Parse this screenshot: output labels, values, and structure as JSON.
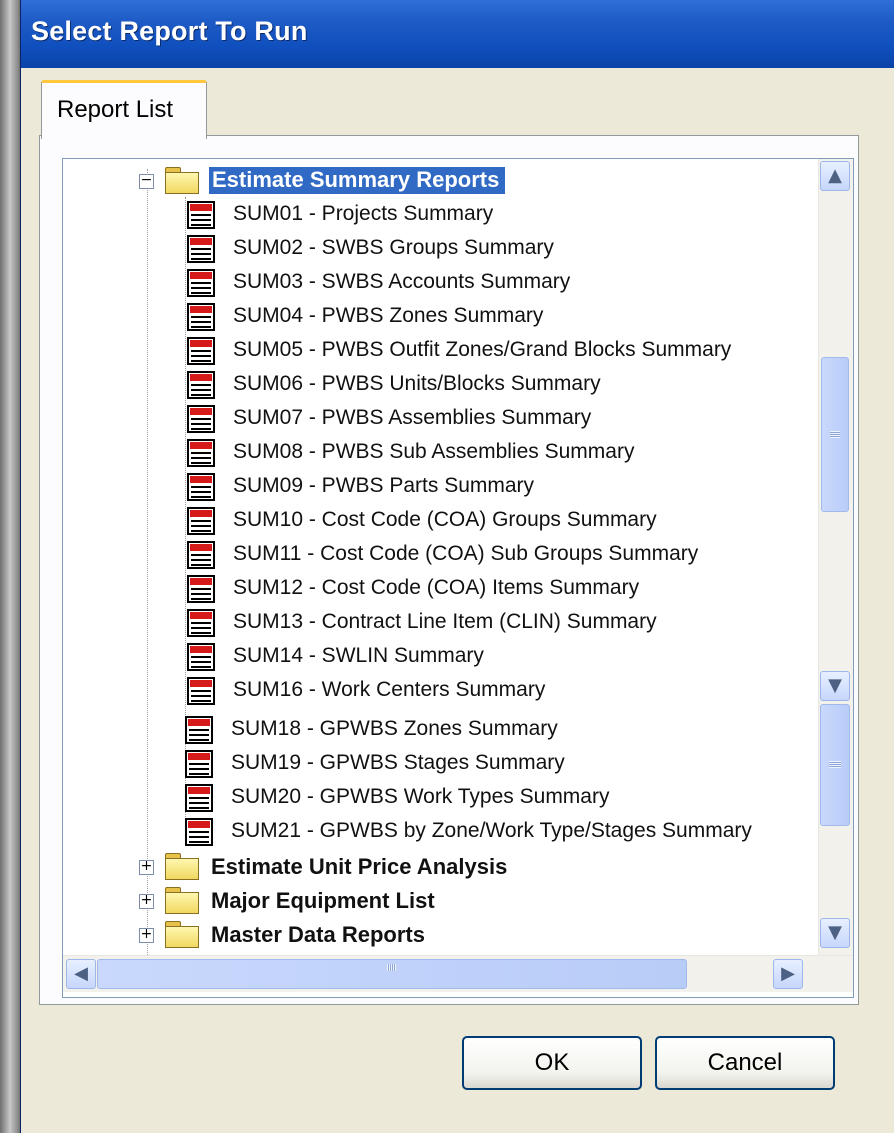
{
  "window": {
    "title": "Select Report To Run"
  },
  "tabs": [
    {
      "label": "Report List"
    }
  ],
  "tree": {
    "expanded_folder": {
      "label": "Estimate Summary Reports",
      "selected": true
    },
    "reports": [
      "SUM01 - Projects Summary",
      "SUM02 - SWBS Groups Summary",
      "SUM03 - SWBS Accounts Summary",
      "SUM04 - PWBS Zones Summary",
      "SUM05 - PWBS Outfit Zones/Grand Blocks Summary",
      "SUM06 - PWBS Units/Blocks Summary",
      "SUM07 - PWBS Assemblies Summary",
      "SUM08 - PWBS Sub Assemblies Summary",
      "SUM09 - PWBS Parts Summary",
      "SUM10 - Cost Code (COA) Groups Summary",
      "SUM11 - Cost Code (COA) Sub Groups Summary",
      "SUM12 - Cost Code (COA) Items Summary",
      "SUM13 - Contract Line Item (CLIN) Summary",
      "SUM14 - SWLIN Summary",
      "SUM16 - Work Centers Summary",
      "SUM18 - GPWBS Zones Summary",
      "SUM19 - GPWBS Stages Summary",
      "SUM20 - GPWBS Work Types Summary",
      "SUM21 - GPWBS by Zone/Work Type/Stages Summary"
    ],
    "collapsed_folders": [
      "Estimate Unit Price Analysis",
      "Major Equipment List",
      "Master Data Reports"
    ]
  },
  "buttons": {
    "ok": "OK",
    "cancel": "Cancel"
  },
  "icons": {
    "expand": "+",
    "collapse": "−",
    "scroll_up": "▲",
    "scroll_down": "▼",
    "scroll_left": "◀",
    "scroll_right": "▶"
  },
  "colors": {
    "title_bar": "#1e5bc6",
    "selection": "#316ac5",
    "tab_highlight": "#ffc83c"
  }
}
